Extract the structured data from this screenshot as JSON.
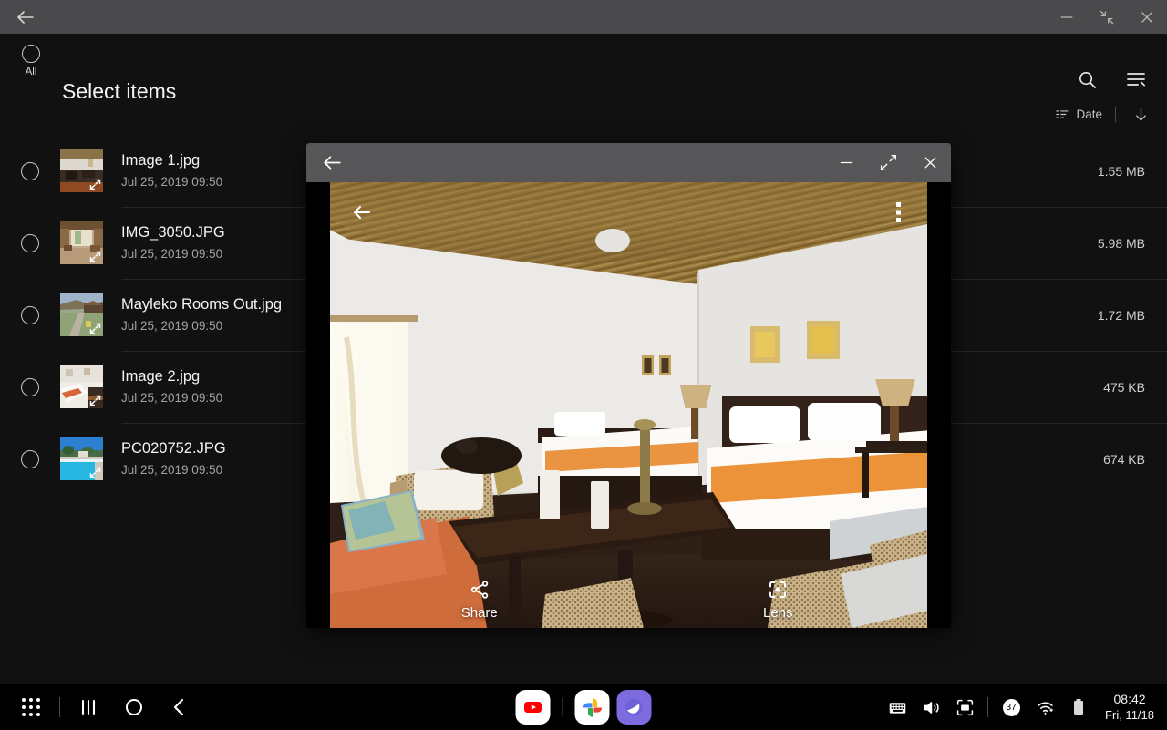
{
  "window": {
    "back_icon": "back-arrow-icon",
    "minimize_label": "—",
    "restore_label": "restore",
    "close_label": "×"
  },
  "header": {
    "title": "Select items",
    "select_all_label": "All",
    "search_icon": "search-icon",
    "menu_icon": "list-menu-icon"
  },
  "sort": {
    "icon": "sort-icon",
    "label": "Date",
    "direction_icon": "arrow-down-icon"
  },
  "files": [
    {
      "name": "Image 1.jpg",
      "date": "Jul 25, 2019 09:50",
      "size": "1.55 MB",
      "thumb": "interior-lounge"
    },
    {
      "name": "IMG_3050.JPG",
      "date": "Jul 25, 2019 09:50",
      "size": "5.98 MB",
      "thumb": "interior-corridor"
    },
    {
      "name": "Mayleko Rooms Out.jpg",
      "date": "Jul 25, 2019 09:50",
      "size": "1.72 MB",
      "thumb": "outdoor-path"
    },
    {
      "name": "Image 2.jpg",
      "date": "Jul 25, 2019 09:50",
      "size": "475 KB",
      "thumb": "bedroom-white"
    },
    {
      "name": "PC020752.JPG",
      "date": "Jul 25, 2019 09:50",
      "size": "674 KB",
      "thumb": "pool-blue"
    }
  ],
  "viewer": {
    "back_icon": "back-arrow-icon",
    "minimize_label": "—",
    "maximize_label": "maximize",
    "close_label": "×",
    "overlay_back_icon": "back-arrow-icon",
    "kebab_icon": "more-vertical-icon",
    "actions": [
      {
        "label": "Share",
        "icon": "share-icon"
      },
      {
        "label": "Lens",
        "icon": "lens-icon"
      }
    ],
    "photo_description": "Hotel room with bamboo thatch ceiling, twin and double beds with orange runners, wicker armchairs and dark wood coffee table"
  },
  "taskbar": {
    "apps_icon": "apps-grid-icon",
    "recents_icon": "recents-icon",
    "home_icon": "home-circle-icon",
    "back_icon": "back-chevron-icon",
    "pinned": [
      {
        "name": "YouTube",
        "icon": "youtube-icon"
      },
      {
        "name": "Google Photos",
        "icon": "google-photos-icon"
      },
      {
        "name": "Samsung Internet",
        "icon": "samsung-internet-icon"
      }
    ],
    "tray": [
      {
        "icon": "keyboard-icon"
      },
      {
        "icon": "volume-icon"
      },
      {
        "icon": "screen-capture-icon"
      }
    ],
    "battery_percent": "37",
    "wifi_icon": "wifi-icon",
    "battery_icon": "battery-icon",
    "time": "08:42",
    "date": "Fri, 11/18"
  },
  "colors": {
    "titlebar": "#4a4a4c",
    "viewer_titlebar": "#565658",
    "app_bg": "#111112",
    "text_primary": "#f4f4f4",
    "text_secondary": "#a3a3a3",
    "accent_orange": "#e8913c"
  }
}
